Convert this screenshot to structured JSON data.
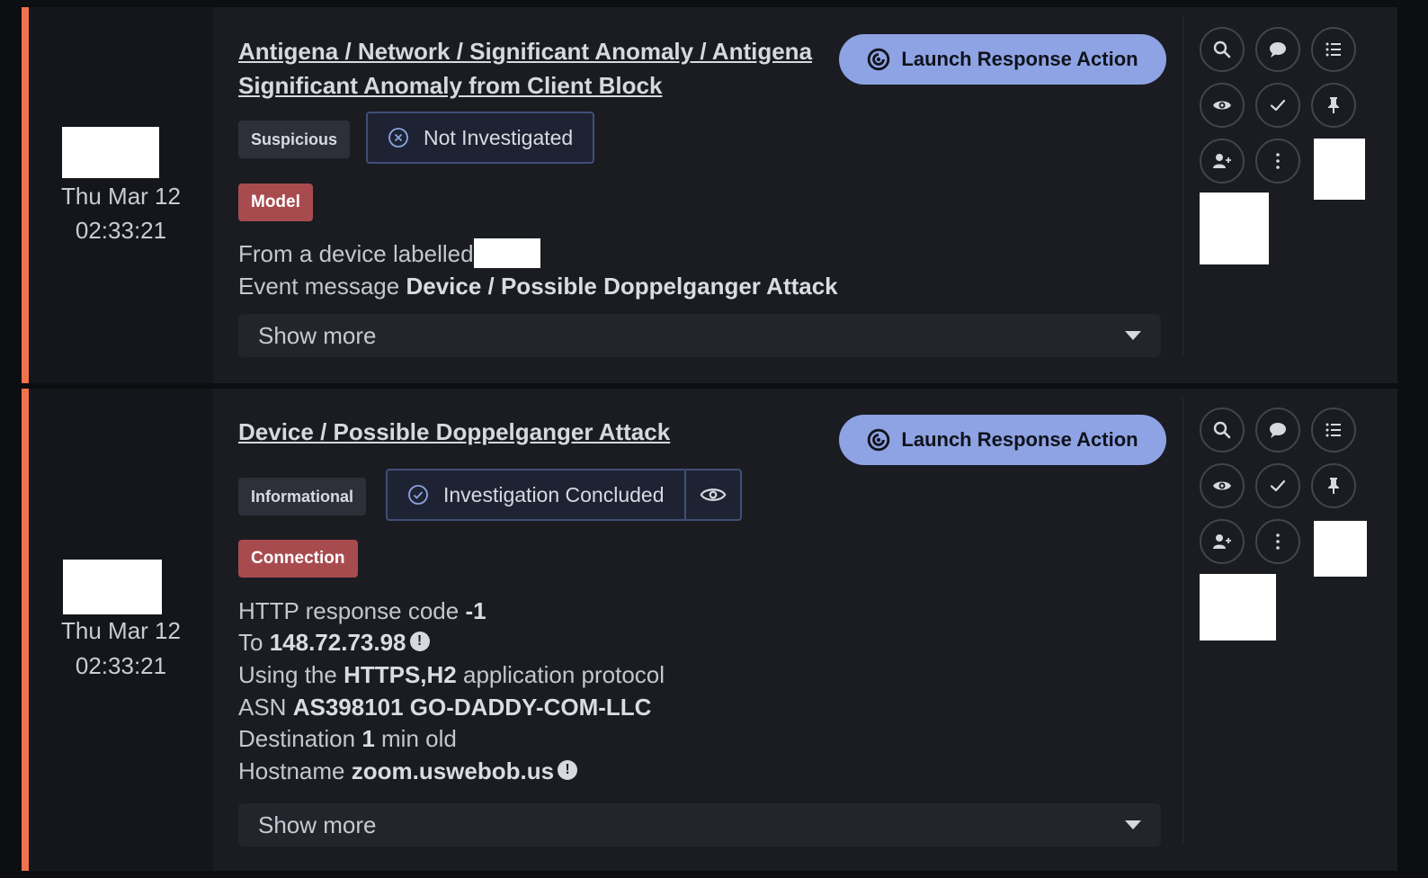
{
  "colors": {
    "accent": "#8ea3e3",
    "stripe": "#f0734d",
    "tag_red": "#a84b4f"
  },
  "alerts": [
    {
      "date": "Thu Mar 12",
      "time": "02:33:21",
      "title": "Antigena / Network / Significant Anomaly / Antigena Significant Anomaly from Client Block",
      "launch_label": "Launch Response Action",
      "severity": "Suspicious",
      "status": "Not Investigated",
      "category": "Model",
      "details": [
        {
          "label": "From a device labelled",
          "value": ""
        },
        {
          "label": "Event message",
          "value": "Device / Possible Doppelganger Attack"
        }
      ],
      "show_more": "Show more"
    },
    {
      "date": "Thu Mar 12",
      "time": "02:33:21",
      "title": "Device / Possible Doppelganger Attack",
      "launch_label": "Launch Response Action",
      "severity": "Informational",
      "status": "Investigation Concluded",
      "category": "Connection",
      "details": [
        {
          "label": "HTTP response code",
          "value": "-1"
        },
        {
          "label": "To",
          "value": "148.72.73.98"
        },
        {
          "label": "Using the",
          "value": "HTTPS,H2",
          "suffix": "application protocol"
        },
        {
          "label": "ASN",
          "value": "AS398101 GO-DADDY-COM-LLC"
        },
        {
          "label": "Destination",
          "value": "1",
          "suffix": "min old"
        },
        {
          "label": "Hostname",
          "value": "zoom.uswebob.us"
        }
      ],
      "show_more": "Show more"
    }
  ],
  "icons": [
    "search-icon",
    "comment-icon",
    "list-icon",
    "eye-icon",
    "check-icon",
    "pin-icon",
    "add-user-icon",
    "more-vertical-icon"
  ],
  "info_glyph": "!"
}
